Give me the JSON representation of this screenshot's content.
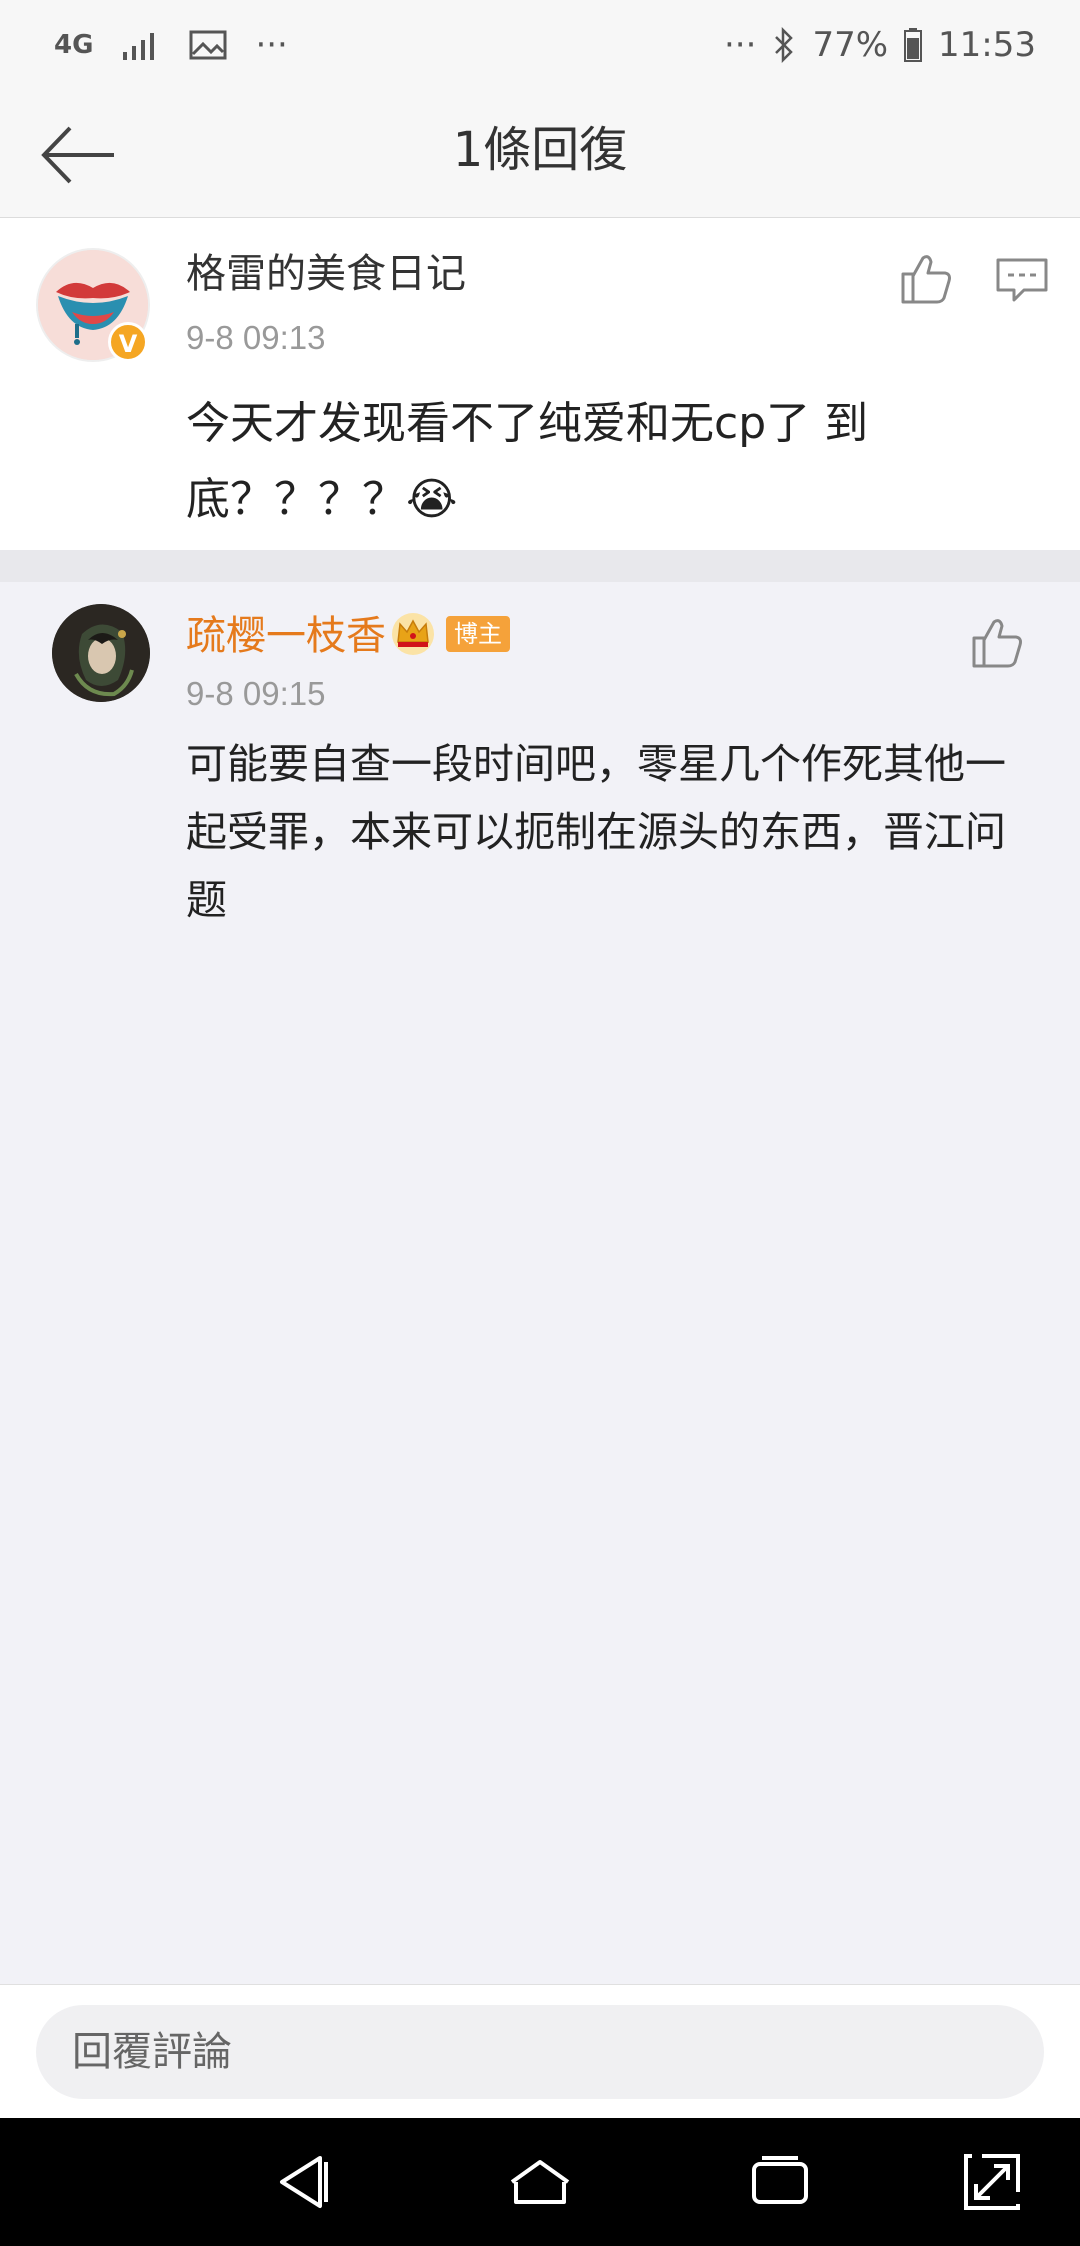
{
  "status_bar": {
    "network": "4G",
    "more_left": "···",
    "more_right": "···",
    "battery": "77%",
    "time": "11:53"
  },
  "header": {
    "title": "1條回復"
  },
  "main_comment": {
    "username": "格雷的美食日记",
    "verified_badge": "V",
    "timestamp": "9-8 09:13",
    "text_line1": "今天才发现看不了纯爱和无cp了 到",
    "text_line2": "底？？？？😭",
    "icons": [
      "thumbs-up-icon",
      "comment-icon"
    ]
  },
  "reply": {
    "username": "疏樱一枝香",
    "badge": "博主",
    "timestamp": "9-8 09:15",
    "text_line1": "可能要自查一段时间吧，零星几个作死其他一",
    "text_line2": "起受罪，本来可以扼制在源头的东西，晋江问",
    "text_line3": "题",
    "icons": [
      "crown-icon",
      "thumbs-up-icon"
    ]
  },
  "reply_bar": {
    "placeholder": "回覆評論"
  },
  "colors": {
    "accent_orange": "#e57a1c",
    "badge_orange": "#f5a23a",
    "background": "#f2f2f7"
  }
}
